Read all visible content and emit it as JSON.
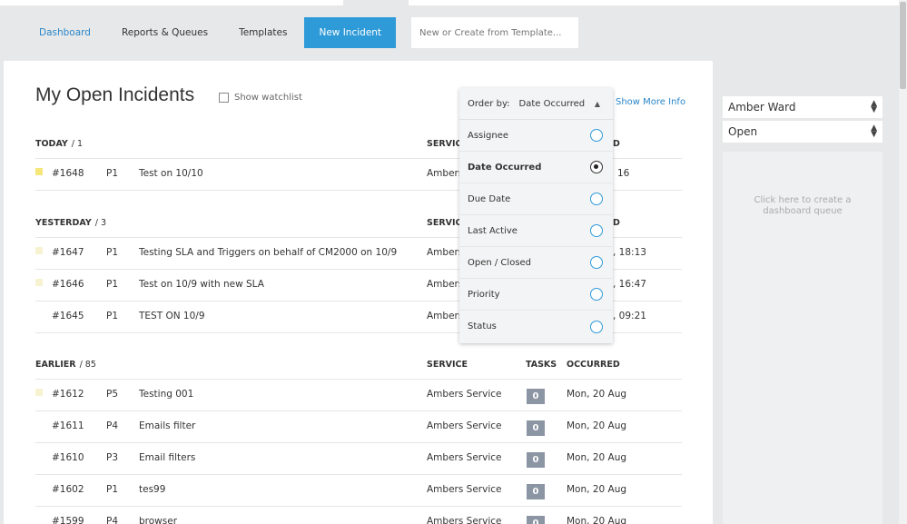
{
  "nav": {
    "items": [
      "Dashboard",
      "Reports & Queues",
      "Templates"
    ],
    "new_incident": "New Incident",
    "search_placeholder": "New or Create from Template..."
  },
  "main": {
    "title": "My Open Incidents",
    "show_watchlist": "Show watchlist",
    "show_more_info": "Show More Info"
  },
  "columns": {
    "service": "SERVICE",
    "tasks": "TASKS",
    "occurred": "OCCURRED"
  },
  "sections": {
    "today": {
      "label": "TODAY",
      "count": "/ 1",
      "rows": [
        {
          "id": "#1648",
          "priority": "P1",
          "title": "Test on 10/10",
          "service": "Ambers",
          "occurred": "16"
        }
      ]
    },
    "yesterday": {
      "label": "YESTERDAY",
      "count": "/ 3",
      "rows": [
        {
          "id": "#1647",
          "priority": "P1",
          "title": "Testing SLA and Triggers on behalf of CM2000 on 10/9",
          "service": "Ambers",
          "occurred": ", 18:13"
        },
        {
          "id": "#1646",
          "priority": "P1",
          "title": "Test on 10/9 with new SLA",
          "service": "Ambers",
          "occurred": ", 16:47"
        },
        {
          "id": "#1645",
          "priority": "P1",
          "title": "TEST ON 10/9",
          "service": "Ambers",
          "occurred": ", 09:21"
        }
      ]
    },
    "earlier": {
      "label": "EARLIER",
      "count": "/ 85",
      "rows": [
        {
          "id": "#1612",
          "priority": "P5",
          "title": "Testing 001",
          "service": "Ambers Service",
          "tasks": "0",
          "occurred": "Mon, 20 Aug"
        },
        {
          "id": "#1611",
          "priority": "P4",
          "title": "Emails filter",
          "service": "Ambers Service",
          "tasks": "0",
          "occurred": "Mon, 20 Aug"
        },
        {
          "id": "#1610",
          "priority": "P3",
          "title": "Email filters",
          "service": "Ambers Service",
          "tasks": "0",
          "occurred": "Mon, 20 Aug"
        },
        {
          "id": "#1602",
          "priority": "P1",
          "title": "tes99",
          "service": "Ambers Service",
          "tasks": "0",
          "occurred": "Mon, 20 Aug"
        },
        {
          "id": "#1599",
          "priority": "P4",
          "title": "browser",
          "service": "Ambers Service",
          "tasks": "0",
          "occurred": "Mon, 20 Aug"
        }
      ]
    }
  },
  "header_partial": {
    "service": "SERVIC",
    "occurred": "D"
  },
  "order_by": {
    "label": "Order by:",
    "selected": "Date Occurred",
    "options": [
      "Assignee",
      "Date Occurred",
      "Due Date",
      "Last Active",
      "Open / Closed",
      "Priority",
      "Status"
    ]
  },
  "right": {
    "assignee": "Amber Ward",
    "status": "Open",
    "queue_hint_line1": "Click here to create a",
    "queue_hint_line2": "dashboard queue"
  },
  "colors": {
    "accent": "#2f9ad8",
    "flag_yellow": "#f5e77a",
    "flag_pale": "#f7f2cf",
    "tasks_badge": "#8c95a3"
  }
}
